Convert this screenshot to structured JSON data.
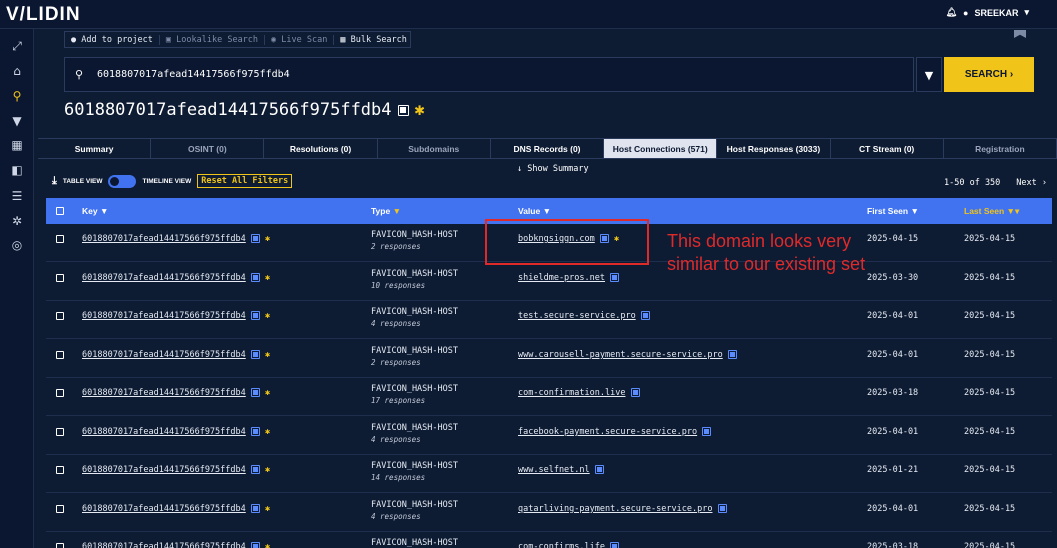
{
  "app": {
    "logo": "V/LIDIN",
    "user": "SREEKAR"
  },
  "toolbar": {
    "add_to_project": "Add to project",
    "lookalike": "Lookalike Search",
    "live_scan": "Live Scan",
    "bulk_search": "Bulk Search"
  },
  "search": {
    "value": "6018807017afead14417566f975ffdb4",
    "button": "SEARCH ›"
  },
  "title": "6018807017afead14417566f975ffdb4",
  "tabs": [
    {
      "label": "Summary"
    },
    {
      "label": "OSINT (0)"
    },
    {
      "label": "Resolutions (0)"
    },
    {
      "label": "Subdomains"
    },
    {
      "label": "DNS Records (0)"
    },
    {
      "label": "Host Connections (571)"
    },
    {
      "label": "Host Responses (3033)"
    },
    {
      "label": "CT Stream (0)"
    },
    {
      "label": "Registration"
    }
  ],
  "show_summary": "↓ Show Summary",
  "view": {
    "table": "TABLE VIEW",
    "timeline": "TIMELINE VIEW",
    "reset": "Reset All Filters"
  },
  "pager": {
    "range": "1-50 of 350",
    "next": "Next ›"
  },
  "columns": {
    "key": "Key",
    "type": "Type",
    "value": "Value",
    "first_seen": "First Seen",
    "last_seen": "Last Seen"
  },
  "rows": [
    {
      "key": "6018807017afead14417566f975ffdb4",
      "type": "FAVICON_HASH-HOST",
      "responses": "2 responses",
      "value": "bobkngsiggn.com",
      "first_seen": "2025-04-15",
      "last_seen": "2025-04-15"
    },
    {
      "key": "6018807017afead14417566f975ffdb4",
      "type": "FAVICON_HASH-HOST",
      "responses": "10 responses",
      "value": "shieldme-pros.net",
      "first_seen": "2025-03-30",
      "last_seen": "2025-04-15"
    },
    {
      "key": "6018807017afead14417566f975ffdb4",
      "type": "FAVICON_HASH-HOST",
      "responses": "4 responses",
      "value": "test.secure-service.pro",
      "first_seen": "2025-04-01",
      "last_seen": "2025-04-15"
    },
    {
      "key": "6018807017afead14417566f975ffdb4",
      "type": "FAVICON_HASH-HOST",
      "responses": "2 responses",
      "value": "www.carousell-payment.secure-service.pro",
      "first_seen": "2025-04-01",
      "last_seen": "2025-04-15"
    },
    {
      "key": "6018807017afead14417566f975ffdb4",
      "type": "FAVICON_HASH-HOST",
      "responses": "17 responses",
      "value": "com-confirmation.live",
      "first_seen": "2025-03-18",
      "last_seen": "2025-04-15"
    },
    {
      "key": "6018807017afead14417566f975ffdb4",
      "type": "FAVICON_HASH-HOST",
      "responses": "4 responses",
      "value": "facebook-payment.secure-service.pro",
      "first_seen": "2025-04-01",
      "last_seen": "2025-04-15"
    },
    {
      "key": "6018807017afead14417566f975ffdb4",
      "type": "FAVICON_HASH-HOST",
      "responses": "14 responses",
      "value": "www.selfnet.nl",
      "first_seen": "2025-01-21",
      "last_seen": "2025-04-15"
    },
    {
      "key": "6018807017afead14417566f975ffdb4",
      "type": "FAVICON_HASH-HOST",
      "responses": "4 responses",
      "value": "qatarliving-payment.secure-service.pro",
      "first_seen": "2025-04-01",
      "last_seen": "2025-04-15"
    },
    {
      "key": "6018807017afead14417566f975ffdb4",
      "type": "FAVICON_HASH-HOST",
      "responses": "",
      "value": "com-confirms.life",
      "first_seen": "2025-03-18",
      "last_seen": "2025-04-15"
    }
  ],
  "annotation": "This domain looks very similar to our existing set",
  "colors": {
    "accent": "#f0c419",
    "header": "#4173f0",
    "annotation": "#e02a2a",
    "background": "#0d1b33"
  }
}
